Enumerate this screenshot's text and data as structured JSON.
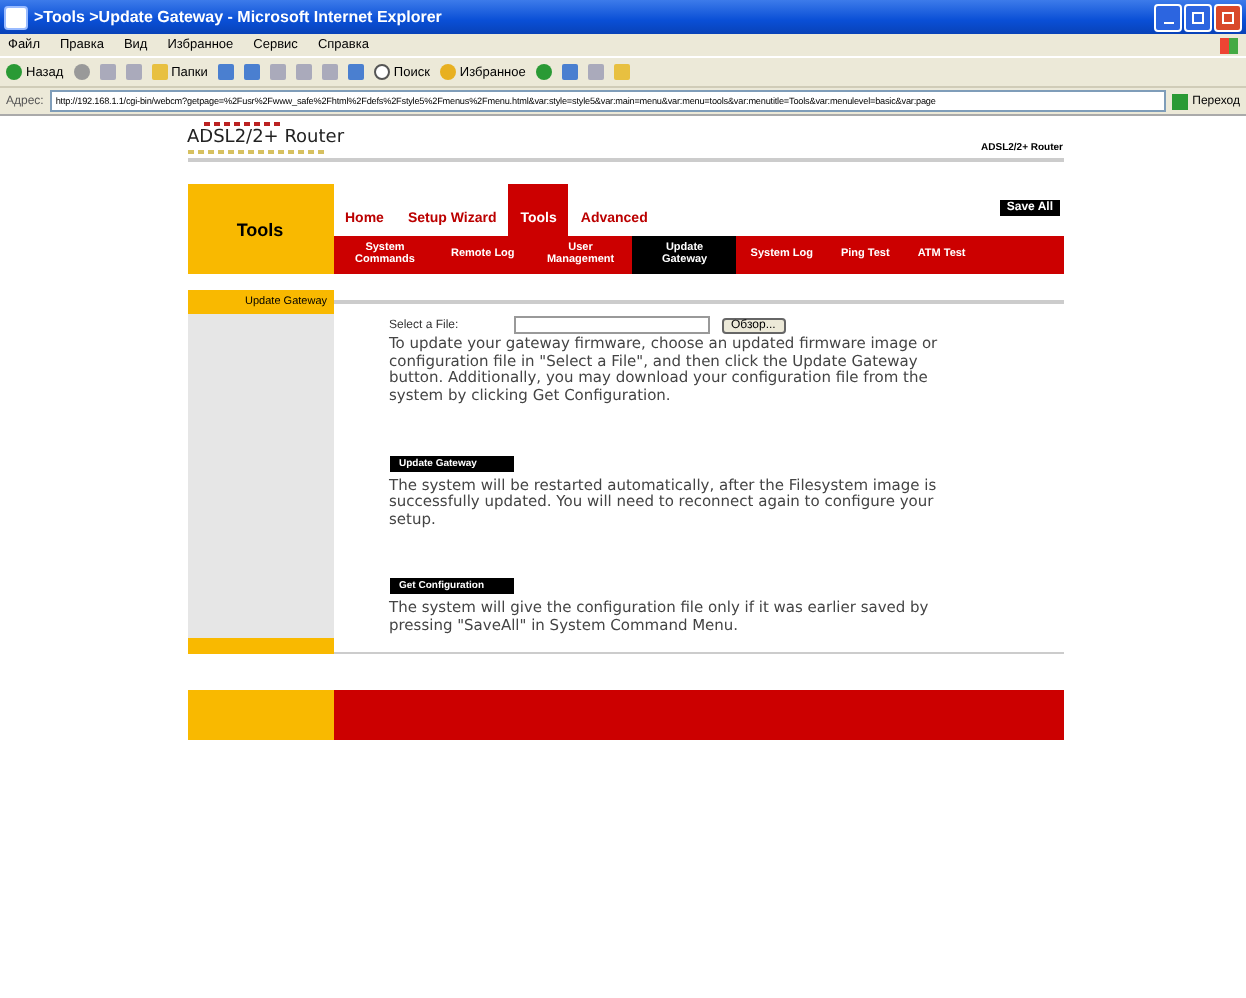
{
  "window": {
    "title": ">Tools >Update Gateway - Microsoft Internet Explorer"
  },
  "menu_bar": [
    "Файл",
    "Правка",
    "Вид",
    "Избранное",
    "Сервис",
    "Справка"
  ],
  "toolbar": {
    "back": "Назад",
    "folders": "Папки",
    "search": "Поиск",
    "favorites": "Избранное"
  },
  "address_bar": {
    "label": "Адрес:",
    "url": "http://192.168.1.1/cgi-bin/webcm?getpage=%2Fusr%2Fwww_safe%2Fhtml%2Fdefs%2Fstyle5%2Fmenus%2Fmenu.html&var:style=style5&var:main=menu&var:menu=tools&var:menutitle=Tools&var:menulevel=basic&var:page",
    "go": "Переход"
  },
  "page": {
    "logo": "ADSL2/2+ Router",
    "product": "ADSL2/2+ Router",
    "section_title": "Tools",
    "main_tabs": [
      {
        "label": "Home",
        "selected": false
      },
      {
        "label": "Setup Wizard",
        "selected": false
      },
      {
        "label": "Tools",
        "selected": true
      },
      {
        "label": "Advanced",
        "selected": false
      }
    ],
    "save_all": "Save All",
    "sub_tabs": [
      {
        "label": "System Commands",
        "selected": false
      },
      {
        "label": "Remote Log",
        "selected": false
      },
      {
        "label": "User Management",
        "selected": false
      },
      {
        "label": "Update Gateway",
        "selected": true
      },
      {
        "label": "System Log",
        "selected": false
      },
      {
        "label": "Ping Test",
        "selected": false
      },
      {
        "label": "ATM Test",
        "selected": false
      }
    ],
    "sidebar": {
      "items": [
        {
          "label": "Update Gateway",
          "selected": true
        }
      ]
    },
    "file_field": {
      "label": "Select a File:",
      "browse": "Обзор..."
    },
    "intro": "To update your gateway firmware, choose an updated firmware image or configuration file in \"Select a File\", and then click the Update Gateway button. Additionally, you may download your configuration file from the system by clicking Get Configuration.",
    "actions": [
      {
        "button": "Update Gateway",
        "text": "The system will be restarted automatically, after the Filesystem image is successfully updated. You will need to reconnect again to configure your setup."
      },
      {
        "button": "Get Configuration",
        "text": "The system will give the configuration file only if it was earlier saved by pressing \"SaveAll\" in System Command Menu."
      }
    ]
  }
}
